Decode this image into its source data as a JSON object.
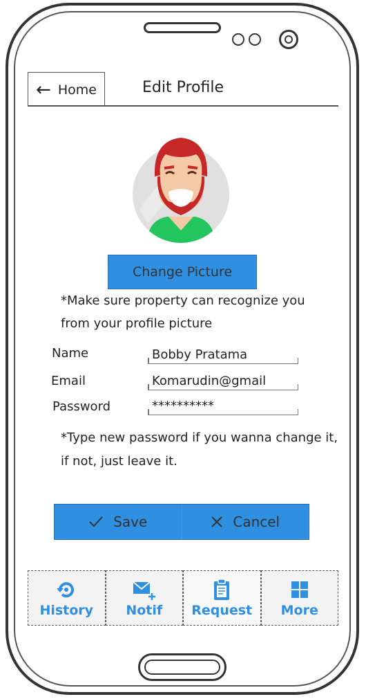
{
  "header": {
    "back_label": "Home",
    "title": "Edit Profile"
  },
  "profile": {
    "change_picture_label": "Change Picture",
    "picture_note_line1": "*Make sure property can recognize you",
    "picture_note_line2": "from your profile picture"
  },
  "form": {
    "fields": [
      {
        "label": "Name",
        "value": "Bobby Pratama"
      },
      {
        "label": "Email",
        "value": "Komarudin@gmail"
      },
      {
        "label": "Password",
        "value": "**********"
      }
    ],
    "password_note_line1": "*Type new password if you wanna change it,",
    "password_note_line2": "if not, just leave it."
  },
  "actions": {
    "save_label": "Save",
    "cancel_label": "Cancel"
  },
  "bottom_nav": {
    "items": [
      {
        "label": "History",
        "icon": "history-icon"
      },
      {
        "label": "Notif",
        "icon": "mail-plus-icon"
      },
      {
        "label": "Request",
        "icon": "clipboard-icon"
      },
      {
        "label": "More",
        "icon": "grid-icon"
      }
    ]
  },
  "colors": {
    "accent": "#2f8fe0",
    "hair": "#c62828",
    "shirt": "#22c55e"
  }
}
